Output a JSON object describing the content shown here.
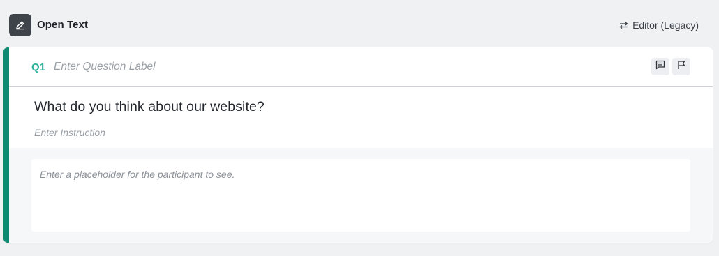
{
  "header": {
    "type_icon": "pencil-icon",
    "title": "Open Text",
    "editor_switch_icon": "swap-arrows-icon",
    "editor_switch_label": "Editor (Legacy)"
  },
  "question": {
    "number": "Q1",
    "label_placeholder": "Enter Question Label",
    "text": "What do you think about our website?",
    "instruction_placeholder": "Enter Instruction",
    "answer_placeholder": "Enter a placeholder for the participant to see.",
    "actions": [
      {
        "icon": "comment-icon"
      },
      {
        "icon": "flag-icon"
      }
    ]
  },
  "colors": {
    "accent": "#0f8a72",
    "question_number": "#2bb39a",
    "header_icon_bg": "#3f434a",
    "page_bg": "#f0f1f3"
  }
}
